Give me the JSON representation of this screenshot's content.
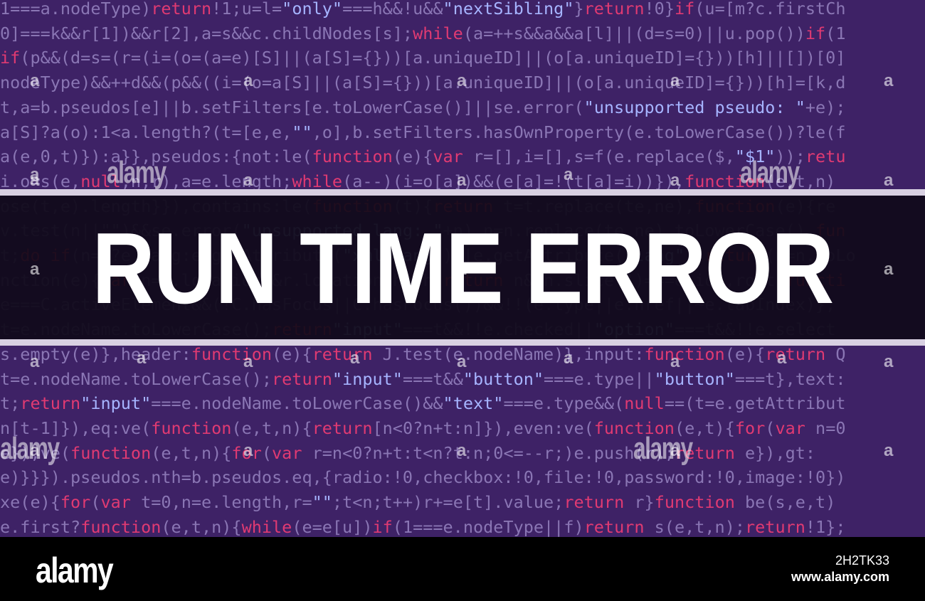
{
  "headline": "RUN TIME ERROR",
  "code_lines": [
    [
      [
        "t",
        "1===a.nodeType)"
      ],
      [
        "k",
        "return"
      ],
      [
        "t",
        "!1;u=l="
      ],
      [
        "s",
        "\"only\""
      ],
      [
        "t",
        "===h&&!u&&"
      ],
      [
        "s",
        "\"nextSibling\""
      ],
      [
        "t",
        "}"
      ],
      [
        "k",
        "return"
      ],
      [
        "t",
        "!0}"
      ],
      [
        "k",
        "if"
      ],
      [
        "t",
        "(u=[m?c.firstCh"
      ]
    ],
    [
      [
        "t",
        "0]===k&&r[1])&&r[2],a=s&&c.childNodes[s];"
      ],
      [
        "k",
        "while"
      ],
      [
        "t",
        "(a=++s&&a&&a[l]||(d=s=0)||u.pop())"
      ],
      [
        "k",
        "if"
      ],
      [
        "t",
        "(1"
      ]
    ],
    [
      [
        "k",
        "if"
      ],
      [
        "t",
        "(p&&(d=s=(r=(i=(o=(a=e)[S]||(a[S]={}))[a.uniqueID]||(o[a.uniqueID]={}))[h]||[])[0]"
      ]
    ],
    [
      [
        "t",
        "nodeType)&&++d&&(p&&((i=(o=a[S]||(a[S]={}))[a.uniqueID]||(o[a.uniqueID]={}))[h]=[k,d"
      ]
    ],
    [
      [
        "t",
        "t,a=b.pseudos[e]||b.setFilters[e.toLowerCase()]||se.error("
      ],
      [
        "s",
        "\"unsupported pseudo: \""
      ],
      [
        "t",
        "+e);"
      ]
    ],
    [
      [
        "t",
        "a[S]?a(o):1<a.length?(t=[e,e,"
      ],
      [
        "s",
        "\"\""
      ],
      [
        "t",
        ",o],b.setFilters.hasOwnProperty(e.toLowerCase())?le(f"
      ]
    ],
    [
      [
        "t",
        "a(e,0,t)}):a}},pseudos:{not:le("
      ],
      [
        "k",
        "function"
      ],
      [
        "t",
        "(e){"
      ],
      [
        "k",
        "var"
      ],
      [
        "t",
        " r=[],i=[],s=f(e.replace($,"
      ],
      [
        "s",
        "\"$1\""
      ],
      [
        "t",
        "));"
      ],
      [
        "k",
        "retu"
      ]
    ],
    [
      [
        "t",
        "i.o=s(e,"
      ],
      [
        "k",
        "null"
      ],
      [
        "t",
        ",n,r),a=e.length;"
      ],
      [
        "k",
        "while"
      ],
      [
        "t",
        "(a--)(i=o[a])&&(e[a]=!(t[a]=i))}),"
      ],
      [
        "k",
        "function"
      ],
      [
        "t",
        "(e,t,n)"
      ]
    ],
    [
      [
        "t",
        "ose(t,e).length}}),contains:le("
      ],
      [
        "k",
        "function"
      ],
      [
        "t",
        "(t){"
      ],
      [
        "k",
        "return"
      ],
      [
        "t",
        " t=t.replace(te,ne),"
      ],
      [
        "k",
        "function"
      ],
      [
        "t",
        "(e){re"
      ]
    ],
    [
      [
        "t",
        "v.test(n||\"\")&&se.error("
      ],
      [
        "s",
        "\"unsupported lang: \""
      ],
      [
        "t",
        "+n),n=n.replace(te,ne).toLowerCase(),"
      ],
      [
        "k",
        "fun"
      ]
    ],
    [
      [
        "t",
        "t;"
      ],
      [
        "k",
        "do"
      ],
      [
        "t",
        " "
      ],
      [
        "k",
        "if"
      ],
      [
        "t",
        "(n=E?e.lang:e.getAttribute("
      ],
      [
        "s",
        "\"xml:lang\""
      ],
      [
        "t",
        ")||e.getAttribute("
      ],
      [
        "s",
        "\"lang\""
      ],
      [
        "t",
        "))"
      ],
      [
        "k",
        "return"
      ],
      [
        "t",
        "(n=n.toLo"
      ]
    ],
    [
      [
        "t",
        "nction(e){"
      ],
      [
        "k",
        "var"
      ],
      [
        "t",
        " n=r.location&&r.location.hash;"
      ],
      [
        "k",
        "return"
      ],
      [
        "t",
        " n&&n.slice(1)===e.id},root:"
      ],
      [
        "k",
        "functi"
      ]
    ],
    [
      [
        "t",
        "e===C.activeElement&&(!C.hasFocus||C.hasFocus())&&!!(e.type||e.href||~e.tabIndex)},"
      ]
    ],
    [
      [
        "t",
        "t=e.nodeName.toLowerCase();"
      ],
      [
        "k",
        "return"
      ],
      [
        "s",
        "\"input\""
      ],
      [
        "t",
        "===t&&!!e.checked||"
      ],
      [
        "s",
        "\"option\""
      ],
      [
        "t",
        "===t&&!!e.select"
      ]
    ],
    [
      [
        "t",
        "s.empty(e)},header:"
      ],
      [
        "k",
        "function"
      ],
      [
        "t",
        "(e){"
      ],
      [
        "k",
        "return"
      ],
      [
        "t",
        " J.test(e.nodeName)},input:"
      ],
      [
        "k",
        "function"
      ],
      [
        "t",
        "(e){"
      ],
      [
        "k",
        "return"
      ],
      [
        "t",
        " Q"
      ]
    ],
    [
      [
        "t",
        "t=e.nodeName.toLowerCase();"
      ],
      [
        "k",
        "return"
      ],
      [
        "s",
        "\"input\""
      ],
      [
        "t",
        "===t&&"
      ],
      [
        "s",
        "\"button\""
      ],
      [
        "t",
        "===e.type||"
      ],
      [
        "s",
        "\"button\""
      ],
      [
        "t",
        "===t},text:"
      ]
    ],
    [
      [
        "t",
        "t;"
      ],
      [
        "k",
        "return"
      ],
      [
        "s",
        "\"input\""
      ],
      [
        "t",
        "===e.nodeName.toLowerCase()&&"
      ],
      [
        "s",
        "\"text\""
      ],
      [
        "t",
        "===e.type&&("
      ],
      [
        "k",
        "null"
      ],
      [
        "t",
        "==(t=e.getAttribut"
      ]
    ],
    [
      [
        "t",
        "n[t-1]}),eq:ve("
      ],
      [
        "k",
        "function"
      ],
      [
        "t",
        "(e,t,n){"
      ],
      [
        "k",
        "return"
      ],
      [
        "t",
        "[n<0?n+t:n]}),even:ve("
      ],
      [
        "k",
        "function"
      ],
      [
        "t",
        "(e,t){"
      ],
      [
        "k",
        "for"
      ],
      [
        "t",
        "("
      ],
      [
        "k",
        "var"
      ],
      [
        "t",
        " n=0"
      ]
    ],
    [
      [
        "t",
        "e}),ve("
      ],
      [
        "k",
        "function"
      ],
      [
        "t",
        "(e,t,n){"
      ],
      [
        "k",
        "for"
      ],
      [
        "t",
        "("
      ],
      [
        "k",
        "var"
      ],
      [
        "t",
        " r=n<0?n+t:t<n?t:n;0<=--r;)e.push(r);"
      ],
      [
        "k",
        "return"
      ],
      [
        "t",
        " e}),gt:"
      ]
    ],
    [
      [
        "t",
        "e)}}}).pseudos.nth=b.pseudos.eq,{radio:!0,checkbox:!0,file:!0,password:!0,image:!0})"
      ]
    ],
    [
      [
        "t",
        "xe(e){"
      ],
      [
        "k",
        "for"
      ],
      [
        "t",
        "("
      ],
      [
        "k",
        "var"
      ],
      [
        "t",
        " t=0,n=e.length,r="
      ],
      [
        "s",
        "\"\""
      ],
      [
        "t",
        ";t<n;t++)r+=e[t].value;"
      ],
      [
        "k",
        "return"
      ],
      [
        "t",
        " r}"
      ],
      [
        "k",
        "function"
      ],
      [
        "t",
        " be(s,e,t)"
      ]
    ],
    [
      [
        "t",
        "e.first?"
      ],
      [
        "k",
        "function"
      ],
      [
        "t",
        "(e,t,n){"
      ],
      [
        "k",
        "while"
      ],
      [
        "t",
        "(e=e[u])"
      ],
      [
        "k",
        "if"
      ],
      [
        "t",
        "(1===e.nodeType||f)"
      ],
      [
        "k",
        "return"
      ],
      [
        "t",
        " s(e,t,n);"
      ],
      [
        "k",
        "return"
      ],
      [
        "t",
        "!1};"
      ]
    ]
  ],
  "watermark": {
    "word": "alamy",
    "letter": "a"
  },
  "footer": {
    "logo": "alamy",
    "image_id": "2H2TK33",
    "url": "www.alamy.com"
  },
  "colors": {
    "background": "#3e2266",
    "code_text": "#8a76b4",
    "keyword": "#e03a72",
    "string": "#a6b4ff",
    "band": "#0e0816",
    "rule": "#d8d0e2",
    "headline": "#ffffff",
    "footer": "#000000"
  }
}
